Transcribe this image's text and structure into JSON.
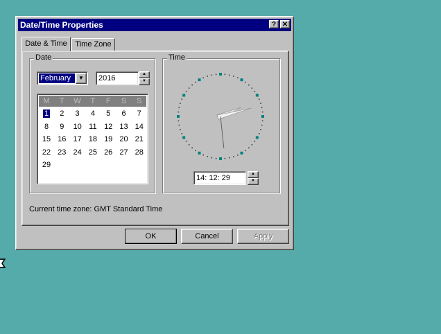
{
  "window": {
    "title": "Date/Time Properties",
    "help_btn": "?",
    "close_btn": "✕"
  },
  "tabs": [
    {
      "label": "Date & Time",
      "active": true
    },
    {
      "label": "Time Zone",
      "active": false
    }
  ],
  "date_group": {
    "label": "Date",
    "month": "February",
    "year": "2016"
  },
  "calendar": {
    "weekdays": [
      "M",
      "T",
      "W",
      "T",
      "F",
      "S",
      "S"
    ],
    "weeks": [
      [
        "1",
        "2",
        "3",
        "4",
        "5",
        "6",
        "7"
      ],
      [
        "8",
        "9",
        "10",
        "11",
        "12",
        "13",
        "14"
      ],
      [
        "15",
        "16",
        "17",
        "18",
        "19",
        "20",
        "21"
      ],
      [
        "22",
        "23",
        "24",
        "25",
        "26",
        "27",
        "28"
      ],
      [
        "29",
        "",
        "",
        "",
        "",
        "",
        ""
      ]
    ],
    "selected_day": "1"
  },
  "time_group": {
    "label": "Time",
    "time": "14: 12: 29",
    "clock": {
      "hour": 14,
      "minute": 12,
      "second": 29
    }
  },
  "timezone_text": "Current time zone:  GMT Standard Time",
  "buttons": {
    "ok": "OK",
    "cancel": "Cancel",
    "apply": "Apply"
  },
  "colors": {
    "desktop": "#55aaaa",
    "titlebar": "#000080",
    "face": "#c0c0c0",
    "clock_marker": "#008080"
  }
}
